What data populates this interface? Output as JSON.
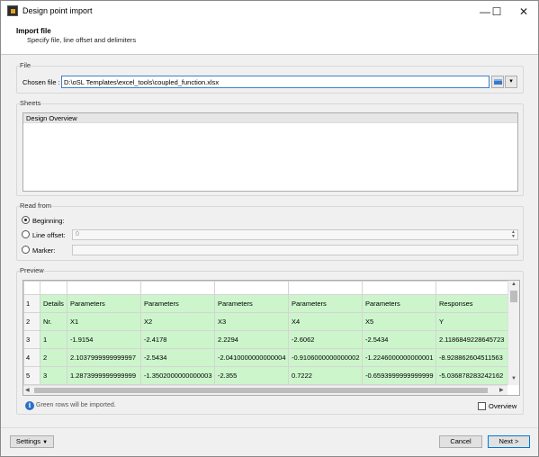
{
  "window": {
    "title": "Design point import",
    "minimize": "—",
    "maximize": "☐",
    "close": "✕"
  },
  "header": {
    "title": "Import file",
    "subtitle": "Specify file, line offset and delimiters"
  },
  "file": {
    "group_label": "File",
    "chosen_label": "Chosen file :",
    "path": "D:\\oSL Templates\\excel_tools\\coupled_function.xlsx",
    "dropdown_glyph": "▾"
  },
  "sheets": {
    "group_label": "Sheets",
    "items": [
      "Design Overview"
    ]
  },
  "read_from": {
    "group_label": "Read from",
    "selected": "beginning",
    "beginning_label": "Beginning:",
    "line_offset_label": "Line offset:",
    "line_offset_value": "0",
    "marker_label": "Marker:"
  },
  "preview": {
    "group_label": "Preview",
    "rows": [
      {
        "num": "1",
        "cells": [
          "Details",
          "Parameters",
          "Parameters",
          "Parameters",
          "Parameters",
          "Parameters",
          "Responses"
        ]
      },
      {
        "num": "2",
        "cells": [
          "Nr.",
          "X1",
          "X2",
          "X3",
          "X4",
          "X5",
          "Y"
        ]
      },
      {
        "num": "3",
        "cells": [
          "1",
          "-1.9154",
          "-2.4178",
          "2.2294",
          "-2.6062",
          "-2.5434",
          "2.1186849228645723"
        ]
      },
      {
        "num": "4",
        "cells": [
          "2",
          "2.1037999999999997",
          "-2.5434",
          "-2.0410000000000004",
          "-0.9106000000000002",
          "-1.2246000000000001",
          "-8.928862604511563"
        ]
      },
      {
        "num": "5",
        "cells": [
          "3",
          "1.2873999999999999",
          "-1.3502000000000003",
          "-2.355",
          "0.7222",
          "-0.6593999999999999",
          "-5.036878283242162"
        ]
      }
    ],
    "info_text": "Green rows will be imported.",
    "overview_label": "Overview"
  },
  "footer": {
    "settings_label": "Settings",
    "cancel_label": "Cancel",
    "next_label": "Next >"
  }
}
